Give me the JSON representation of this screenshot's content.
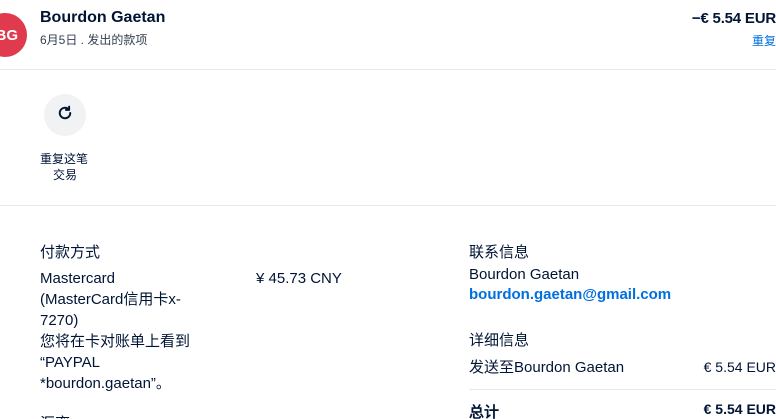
{
  "transaction": {
    "avatar_initials": "BG",
    "name": "Bourdon Gaetan",
    "subtitle": "6月5日 . 发出的款项",
    "amount": "−€ 5.54 EUR",
    "amount_sub": "重复",
    "avatar_color": "#e03a4e"
  },
  "actions": {
    "repeat_icon": "repeat-icon",
    "repeat_label_line1": "重复这笔",
    "repeat_label_line2": "交易"
  },
  "payment": {
    "title": "付款方式",
    "lines": [
      "Mastercard",
      "(MasterCard信用卡x-",
      "7270)",
      "您将在卡对账单上看到",
      "“PAYPAL",
      "*bourdon.gaetan”。"
    ],
    "cny_amount": "¥ 45.73 CNY",
    "next_title": "汇率"
  },
  "contact": {
    "title": "联系信息",
    "name": "Bourdon Gaetan",
    "email": "bourdon.gaetan@gmail.com"
  },
  "details": {
    "title": "详细信息",
    "send_to_label": "发送至Bourdon Gaetan",
    "send_to_value": "€ 5.54 EUR",
    "total_label": "总计",
    "total_value": "€ 5.54 EUR"
  },
  "colors": {
    "link": "#0070e0",
    "text": "#001435"
  }
}
